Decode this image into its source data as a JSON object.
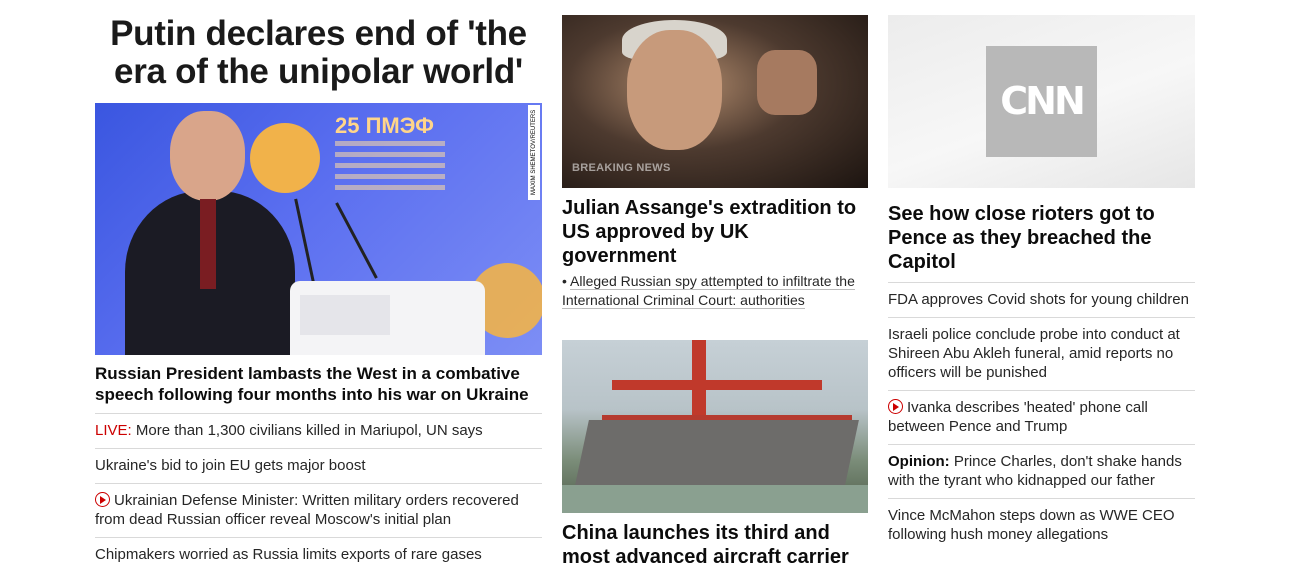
{
  "lead": {
    "title": "Putin declares end of 'the era of the unipolar world'",
    "image_credit": "MAXIM SHEMETOV/REUTERS",
    "image_event_text": "25 ПМЭФ",
    "headline": "Russian President lambasts the West in a combative speech following four months into his war on Ukraine",
    "links": [
      {
        "prefix": "LIVE:",
        "text": "More than 1,300 civilians killed in Mariupol, UN says"
      },
      {
        "text": "Ukraine's bid to join EU gets major boost"
      },
      {
        "video": true,
        "text": "Ukrainian Defense Minister: Written military orders recovered from dead Russian officer reveal Moscow's initial plan"
      },
      {
        "text": "Chipmakers worried as Russia limits exports of rare gases"
      }
    ]
  },
  "middle": {
    "story1": {
      "image_overlay": "BREAKING NEWS",
      "headline": "Julian Assange's extradition to US approved by UK government",
      "bullet": "Alleged Russian spy attempted to infiltrate the International Criminal Court: authorities"
    },
    "story2": {
      "headline": "China launches its third and most advanced aircraft carrier"
    }
  },
  "right": {
    "logo_text": "CNN",
    "headline": "See how close rioters got to Pence as they breached the Capitol",
    "links": [
      {
        "text": "FDA approves Covid shots for young children"
      },
      {
        "text": "Israeli police conclude probe into conduct at Shireen Abu Akleh funeral, amid reports no officers will be punished"
      },
      {
        "video": true,
        "text": "Ivanka describes 'heated' phone call between Pence and Trump"
      },
      {
        "prefix": "Opinion:",
        "text": "Prince Charles, don't shake hands with the tyrant who kidnapped our father"
      },
      {
        "text": "Vince McMahon steps down as WWE CEO following hush money allegations"
      }
    ]
  },
  "colors": {
    "accent_red": "#cc0000",
    "text": "#0c0c0c",
    "divider": "#d9d9d9"
  }
}
